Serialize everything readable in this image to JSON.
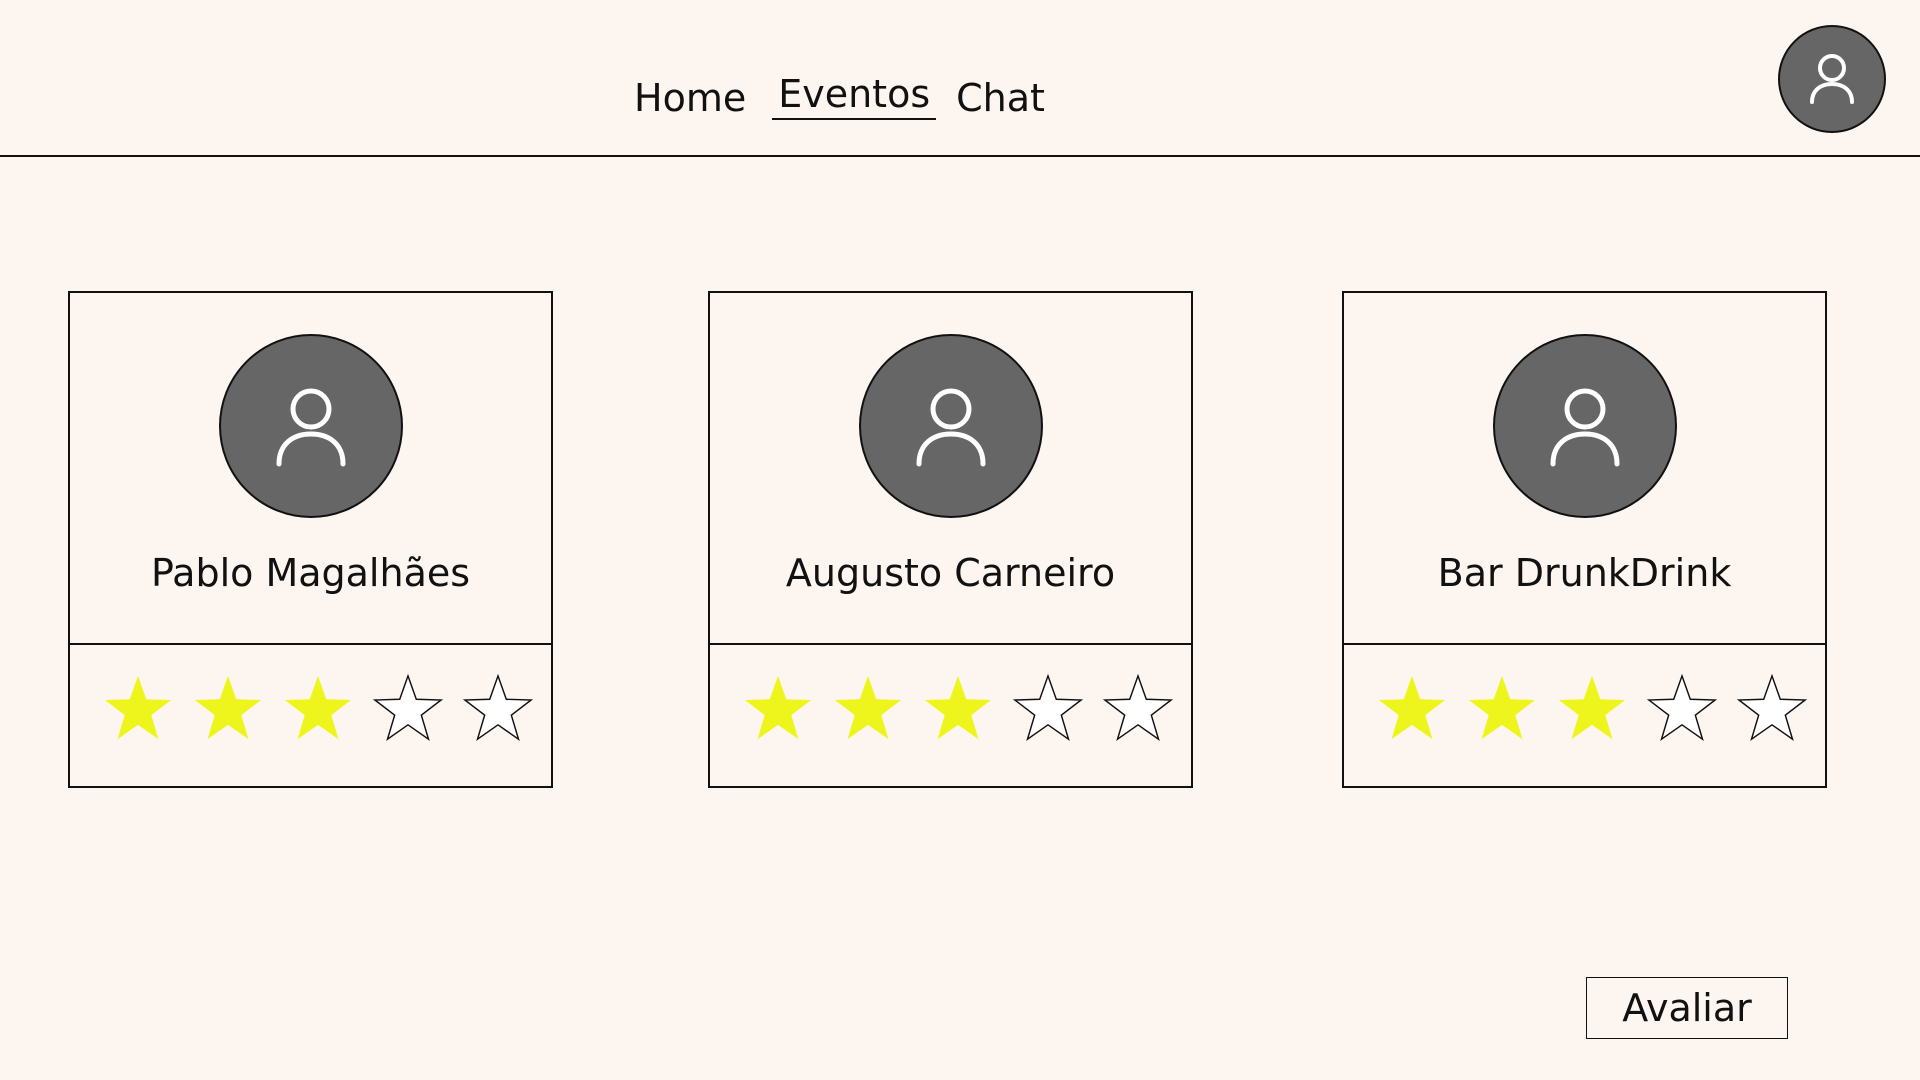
{
  "nav": {
    "home": "Home",
    "events": "Eventos",
    "chat": "Chat",
    "active": "Eventos"
  },
  "profile": {
    "icon": "user-icon"
  },
  "cards": [
    {
      "name": "Pablo Magalhães",
      "rating": 3,
      "max_rating": 5,
      "icon": "user-icon"
    },
    {
      "name": "Augusto Carneiro",
      "rating": 3,
      "max_rating": 5,
      "icon": "user-icon"
    },
    {
      "name": "Bar DrunkDrink",
      "rating": 3,
      "max_rating": 5,
      "icon": "user-icon"
    }
  ],
  "actions": {
    "rate_label": "Avaliar"
  },
  "colors": {
    "background": "#fdf6f0",
    "avatar": "#666666",
    "star_filled": "#eef51c",
    "star_empty": "#ffffff",
    "line": "#111111"
  }
}
